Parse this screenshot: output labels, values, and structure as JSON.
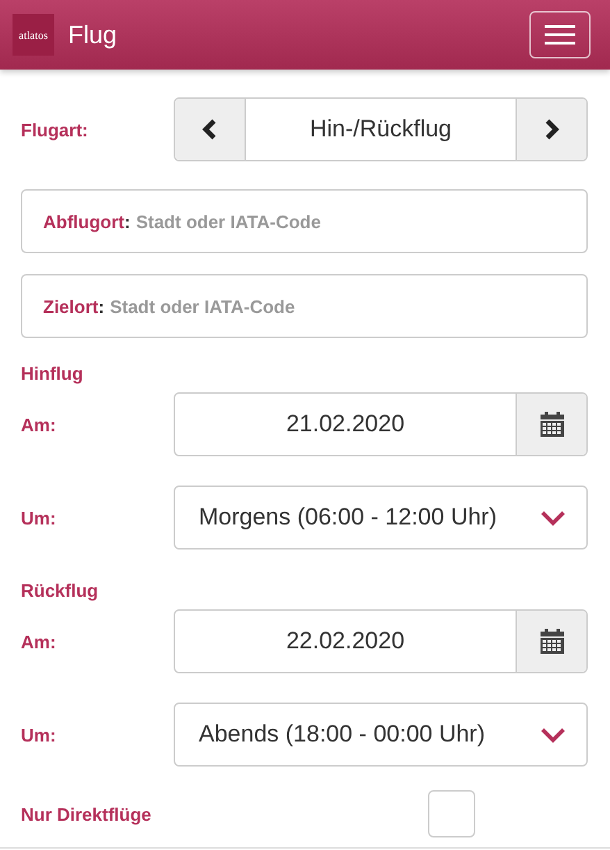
{
  "header": {
    "logo": "atlatos",
    "title": "Flug"
  },
  "trip_type": {
    "label": "Flugart:",
    "value": "Hin-/Rückflug"
  },
  "places": [
    {
      "label": "Abflugort",
      "separator": ":",
      "placeholder": "Stadt oder IATA-Code"
    },
    {
      "label": "Zielort",
      "separator": ":",
      "placeholder": "Stadt oder IATA-Code"
    }
  ],
  "legs": [
    {
      "heading": "Hinflug",
      "date_label": "Am:",
      "date": "21.02.2020",
      "time_label": "Um:",
      "time": "Morgens (06:00 - 12:00 Uhr)"
    },
    {
      "heading": "Rückflug",
      "date_label": "Am:",
      "date": "22.02.2020",
      "time_label": "Um:",
      "time": "Abends (18:00 - 00:00 Uhr)"
    }
  ],
  "direct_only": {
    "label": "Nur Direktflüge",
    "checked": false
  }
}
